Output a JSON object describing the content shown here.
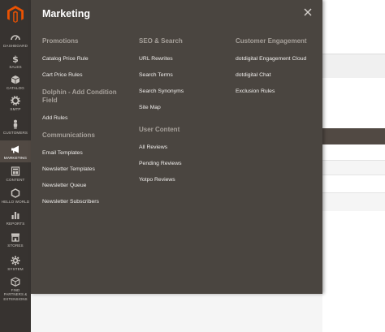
{
  "flyout": {
    "title": "Marketing",
    "columns": [
      {
        "groups": [
          {
            "title": "Promotions",
            "items": [
              "Catalog Price Rule",
              "Cart Price Rules"
            ]
          },
          {
            "title": "Dolphin - Add Condition Field",
            "items": [
              "Add Rules"
            ]
          },
          {
            "title": "Communications",
            "items": [
              "Email Templates",
              "Newsletter Templates",
              "Newsletter Queue",
              "Newsletter Subscribers"
            ]
          }
        ]
      },
      {
        "groups": [
          {
            "title": "SEO & Search",
            "items": [
              "URL Rewrites",
              "Search Terms",
              "Search Synonyms",
              "Site Map"
            ]
          },
          {
            "title": "User Content",
            "items": [
              "All Reviews",
              "Pending Reviews",
              "Yotpo Reviews"
            ]
          }
        ]
      },
      {
        "groups": [
          {
            "title": "Customer Engagement",
            "items": [
              "dotdigital Engagement Cloud",
              "dotdigital Chat",
              "Exclusion Rules"
            ]
          }
        ]
      }
    ]
  },
  "sidebar": {
    "items": [
      {
        "label": "Dashboard",
        "icon": "dashboard-icon"
      },
      {
        "label": "Sales",
        "icon": "dollar-icon"
      },
      {
        "label": "Catalog",
        "icon": "box-icon"
      },
      {
        "label": "SMTP",
        "icon": "gear-icon"
      },
      {
        "label": "Customers",
        "icon": "person-icon"
      },
      {
        "label": "Marketing",
        "icon": "megaphone-icon"
      },
      {
        "label": "Content",
        "icon": "layout-icon"
      },
      {
        "label": "Hello World",
        "icon": "hexagon-icon"
      },
      {
        "label": "Reports",
        "icon": "bar-chart-icon"
      },
      {
        "label": "Stores",
        "icon": "store-icon"
      },
      {
        "label": "System",
        "icon": "cog-icon"
      },
      {
        "label": "Find Partners & Extensions",
        "icon": "cube-icon"
      }
    ],
    "active": "Marketing"
  },
  "colors": {
    "sidebar_bg": "#373330",
    "flyout_bg": "#4a4540",
    "accent": "#eb5202"
  }
}
